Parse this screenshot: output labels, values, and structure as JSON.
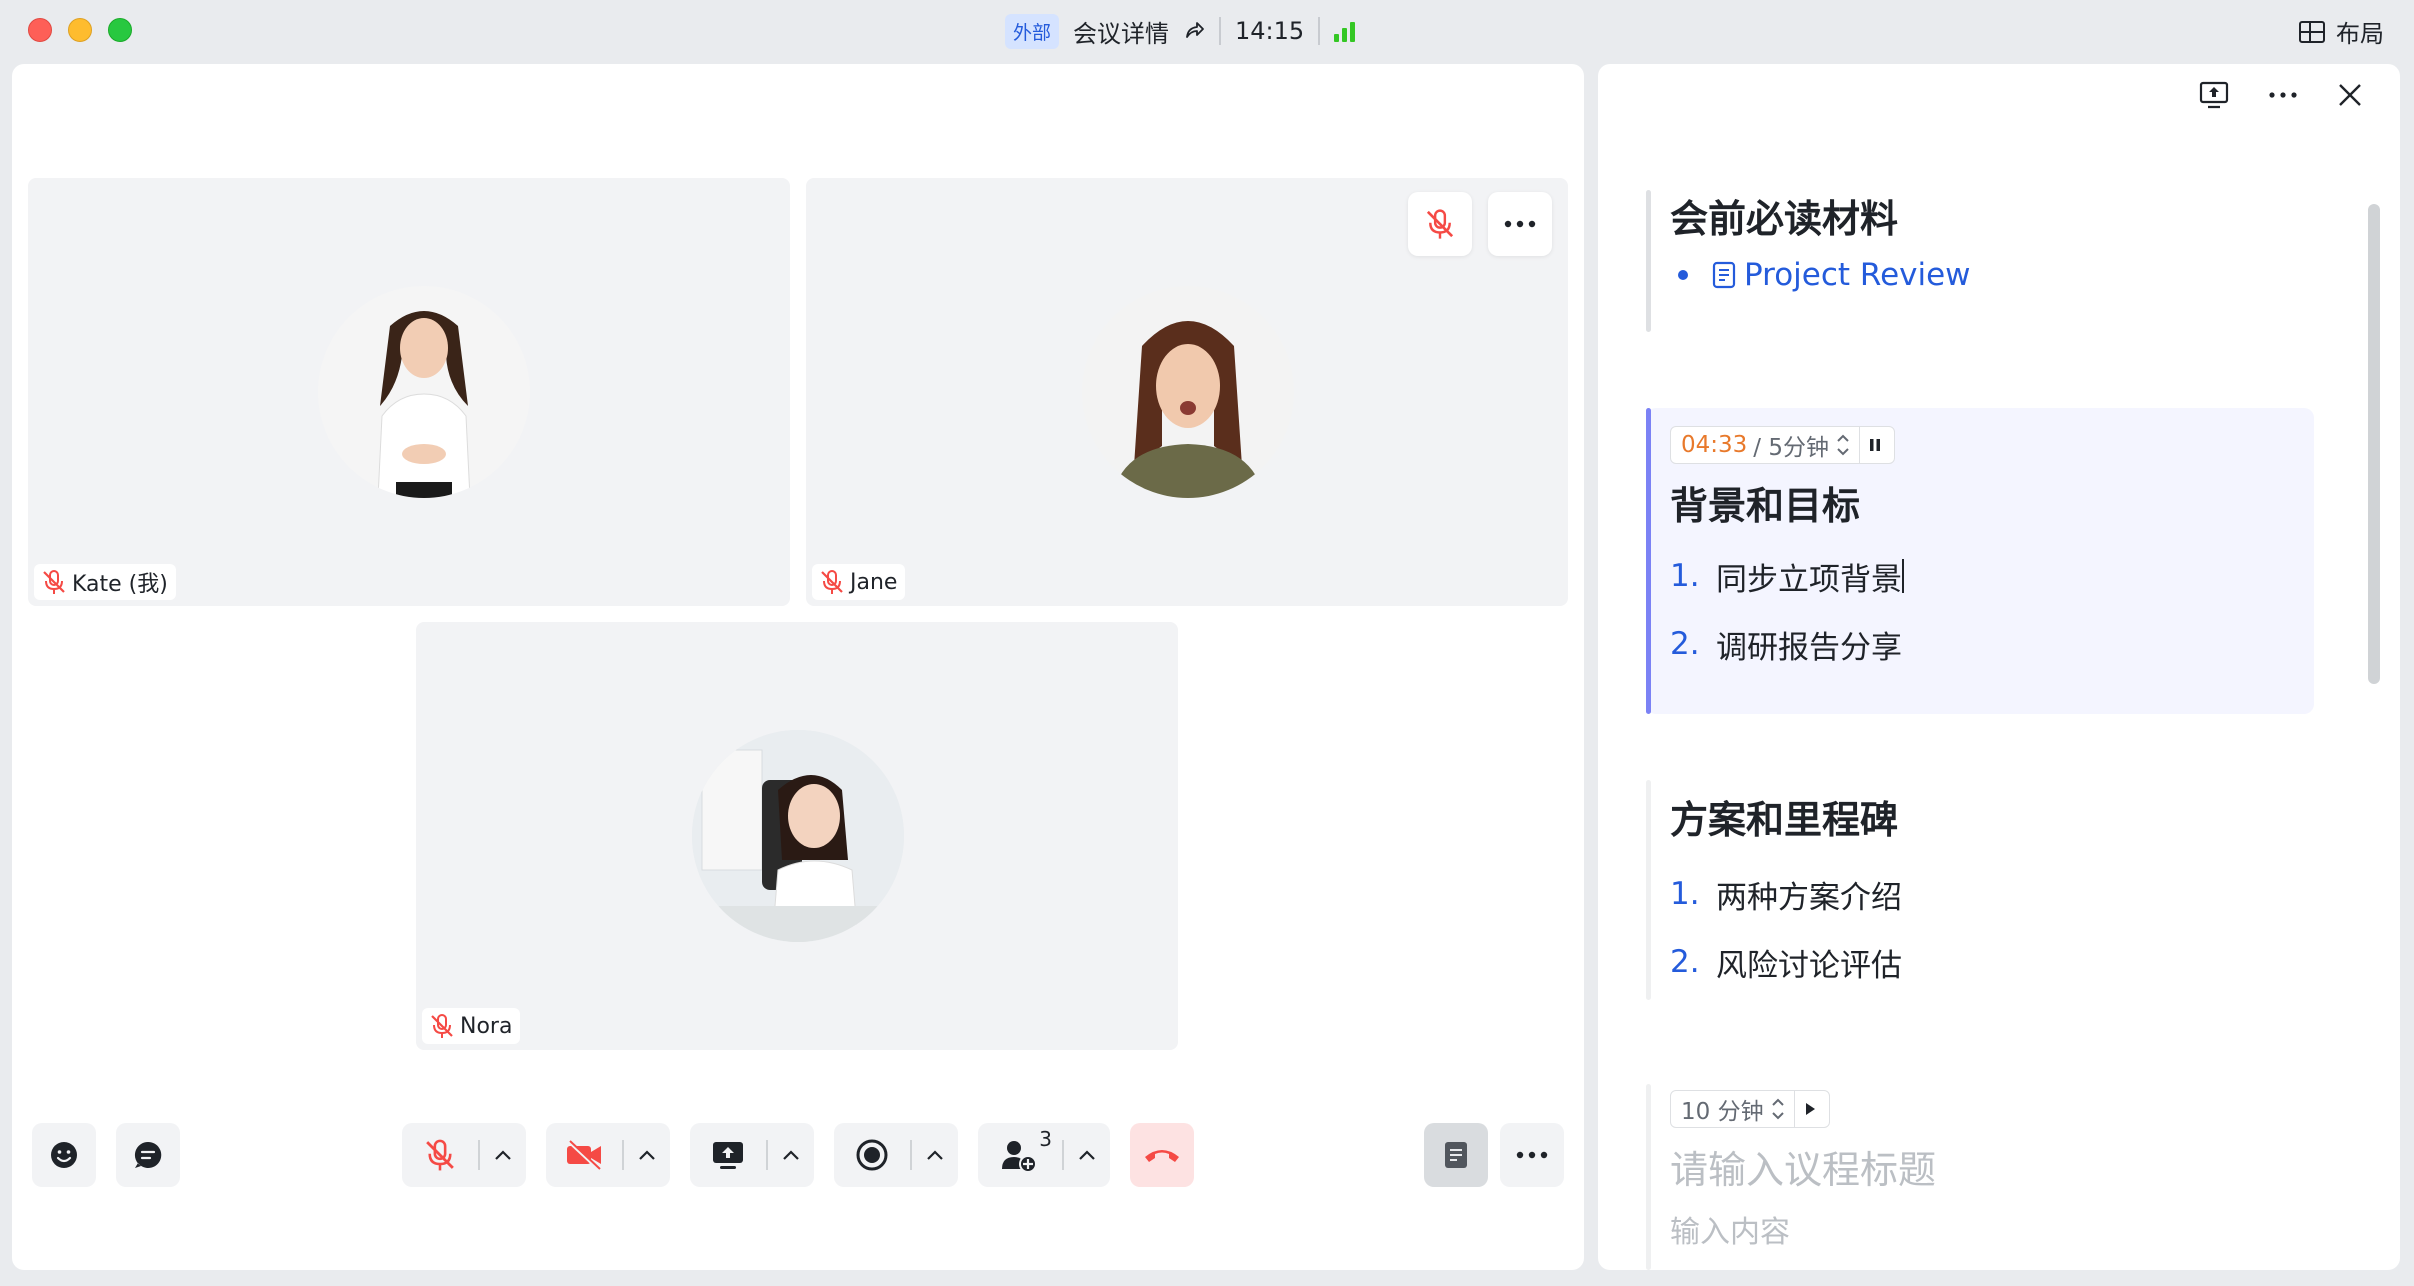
{
  "titlebar": {
    "badge": "外部",
    "meeting_details": "会议详情",
    "time": "14:15",
    "layout_label": "布局"
  },
  "participants": [
    {
      "name": "Kate (我)",
      "muted": true
    },
    {
      "name": "Jane",
      "muted": true
    },
    {
      "name": "Nora",
      "muted": true
    }
  ],
  "toolbar": {
    "participants_count": "3"
  },
  "agenda": {
    "prereading": {
      "title": "会前必读材料",
      "doc_link": "Project Review"
    },
    "items": [
      {
        "elapsed": "04:33",
        "duration": "/ 5分钟",
        "title": "背景和目标",
        "points": [
          {
            "num": "1.",
            "text": "同步立项背景"
          },
          {
            "num": "2.",
            "text": "调研报告分享"
          }
        ]
      },
      {
        "title": "方案和里程碑",
        "points": [
          {
            "num": "1.",
            "text": "两种方案介绍"
          },
          {
            "num": "2.",
            "text": "风险讨论评估"
          }
        ]
      }
    ],
    "new_item": {
      "duration": "10 分钟",
      "title_placeholder": "请输入议程标题",
      "content_placeholder": "输入内容"
    }
  },
  "colors": {
    "accent": "#245bdb",
    "timer_elapsed": "#e8792b",
    "mute_red": "#f54a45",
    "hangup_bg": "#fde2e2",
    "active_section_bar": "#7b82f5",
    "signal_green": "#34c724"
  }
}
